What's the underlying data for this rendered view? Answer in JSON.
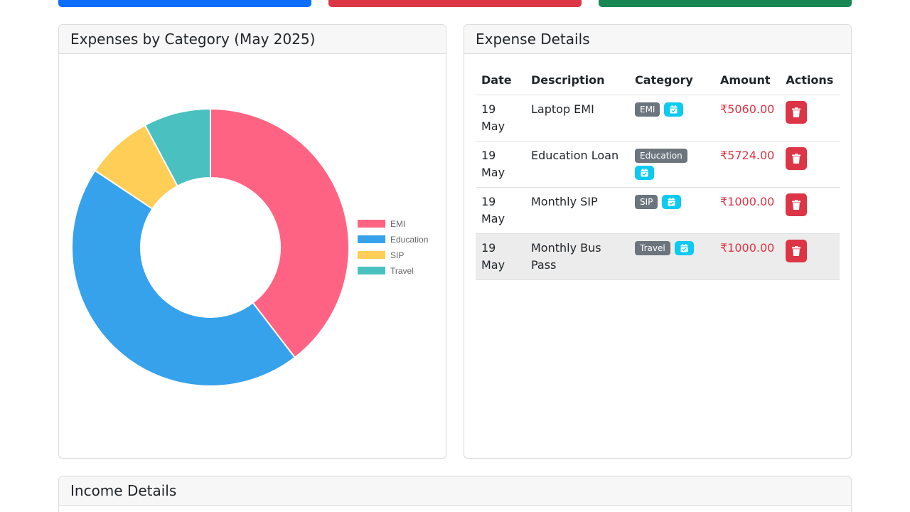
{
  "chart_card": {
    "title": "Expenses by Category (May 2025)"
  },
  "details_card": {
    "title": "Expense Details",
    "headers": [
      "Date",
      "Description",
      "Category",
      "Amount",
      "Actions"
    ],
    "rows": [
      {
        "date": "19 May",
        "description": "Laptop EMI",
        "category": "EMI",
        "amount": "₹5060.00"
      },
      {
        "date": "19 May",
        "description": "Education Loan",
        "category": "Education",
        "amount": "₹5724.00"
      },
      {
        "date": "19 May",
        "description": "Monthly SIP",
        "category": "SIP",
        "amount": "₹1000.00"
      },
      {
        "date": "19 May",
        "description": "Monthly Bus Pass",
        "category": "Travel",
        "amount": "₹1000.00"
      }
    ]
  },
  "income_card": {
    "title": "Income Details"
  },
  "colors": {
    "emi": "#ff6384",
    "education": "#36a2eb",
    "sip": "#ffce56",
    "travel": "#4bc0c0",
    "danger": "#dc3545",
    "info": "#0dcaf0"
  },
  "chart_data": {
    "type": "pie",
    "categories": [
      "EMI",
      "Education",
      "SIP",
      "Travel"
    ],
    "values": [
      5060,
      5724,
      1000,
      1000
    ],
    "colors": [
      "#ff6384",
      "#36a2eb",
      "#ffce56",
      "#4bc0c0"
    ],
    "donut": true,
    "legend": "right"
  }
}
